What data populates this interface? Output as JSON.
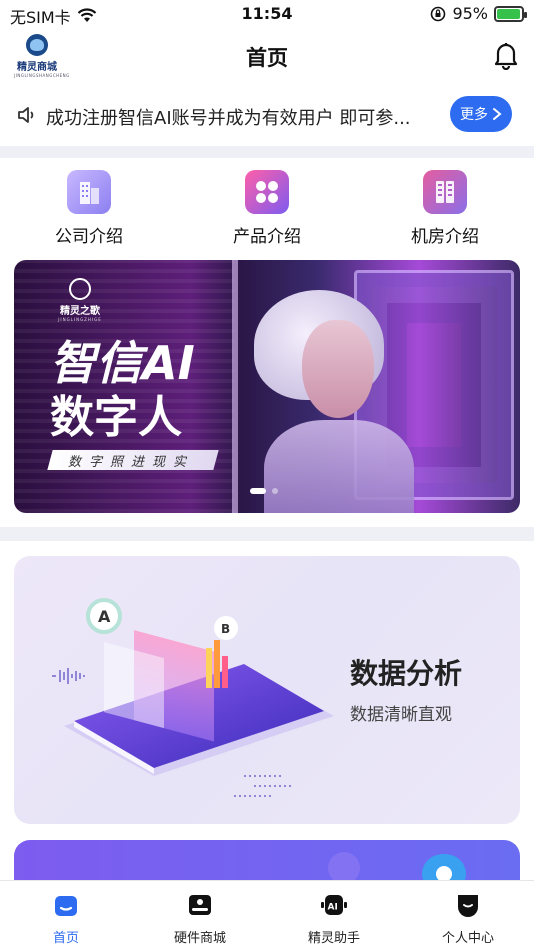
{
  "status_bar": {
    "carrier": "无SIM卡",
    "time": "11:54",
    "battery_percent": "95%",
    "battery_level": 0.95
  },
  "header": {
    "logo_text": "精灵商城",
    "logo_subtext": "JINGLINGSHANGCHENG",
    "title": "首页"
  },
  "notice": {
    "text": "成功注册智信AI账号并成为有效用户 即可参...",
    "more_label": "更多"
  },
  "quick_links": [
    {
      "label": "公司介绍",
      "icon": "building-icon",
      "color": "#8b7ff0"
    },
    {
      "label": "产品介绍",
      "icon": "clover-icon",
      "color": "#e0507a"
    },
    {
      "label": "机房介绍",
      "icon": "server-icon",
      "color": "#8a6ee8"
    }
  ],
  "banner": {
    "brand_name": "精灵之歌",
    "brand_sub": "JINGLINGZHIGE",
    "headline_1": "智信AI",
    "headline_2": "数字人",
    "tagline": "数字照进现实",
    "slides": 2,
    "active_slide": 1
  },
  "feature_card": {
    "title": "数据分析",
    "subtitle": "数据清晰直观",
    "marker_a": "A",
    "marker_b": "B"
  },
  "tabbar": {
    "items": [
      {
        "label": "首页",
        "icon": "home-icon",
        "active": true
      },
      {
        "label": "硬件商城",
        "icon": "hardware-icon",
        "active": false
      },
      {
        "label": "精灵助手",
        "icon": "ai-assistant-icon",
        "active": false
      },
      {
        "label": "个人中心",
        "icon": "profile-icon",
        "active": false
      }
    ]
  },
  "colors": {
    "accent": "#2d6cf0",
    "page_divider": "#eef0f6"
  }
}
